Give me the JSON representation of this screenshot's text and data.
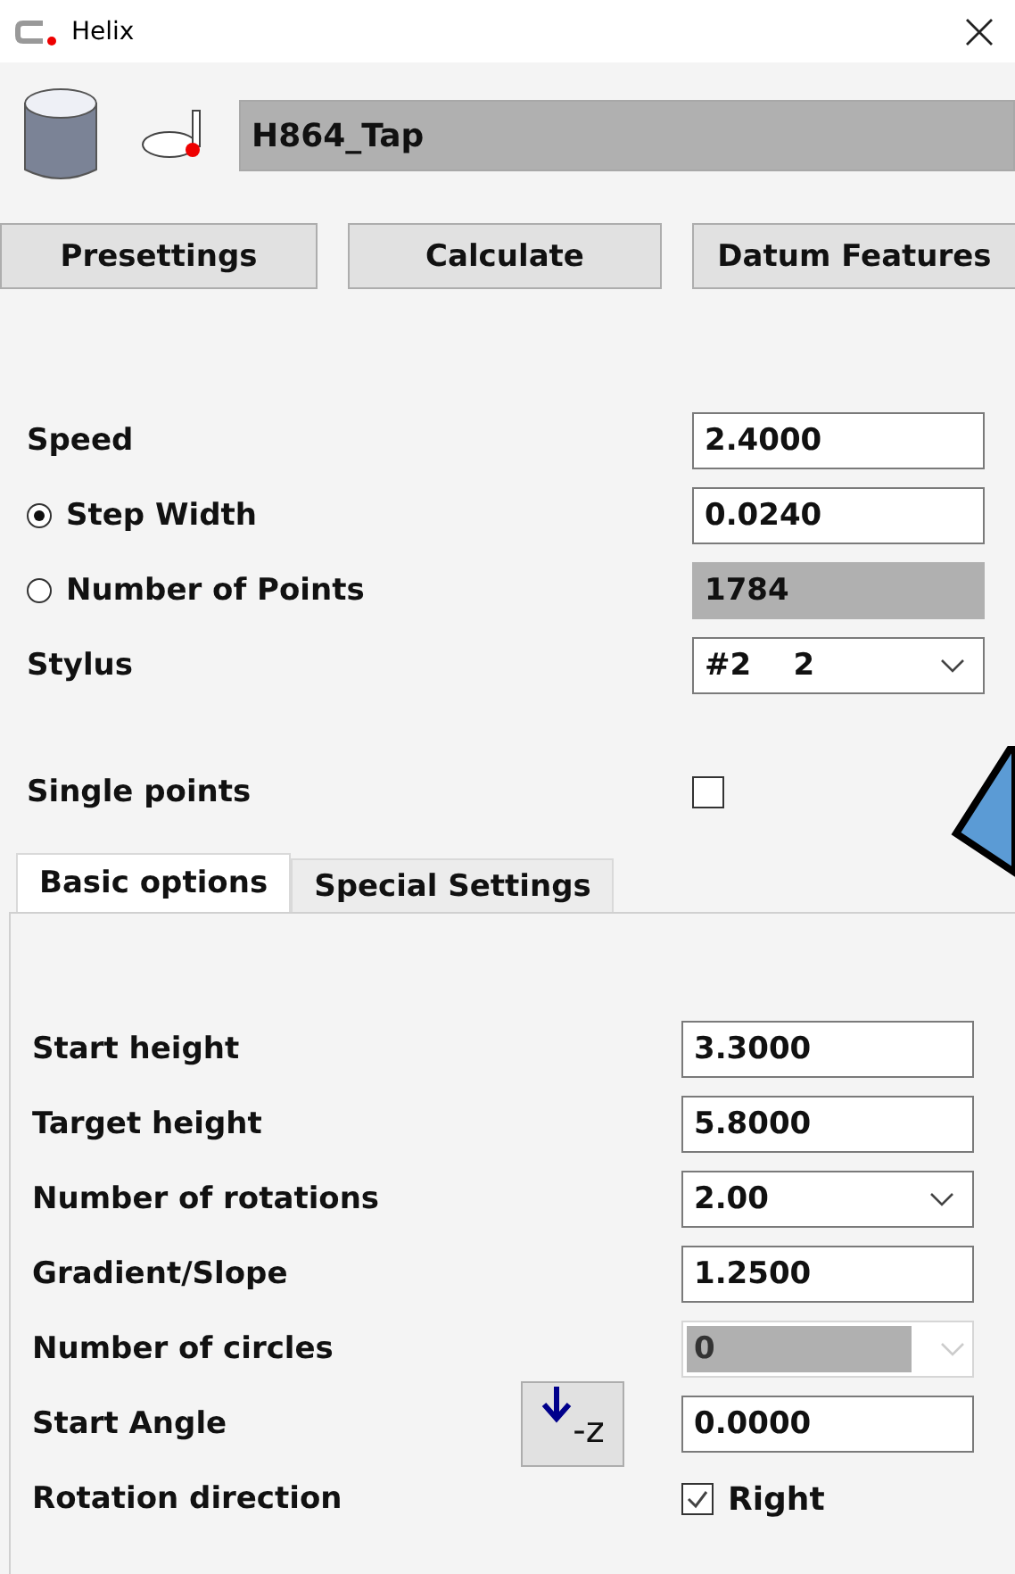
{
  "window": {
    "title": "Helix"
  },
  "header": {
    "name": "H864_Tap"
  },
  "buttons": [
    "Presettings",
    "Calculate",
    "Datum Features"
  ],
  "fields": [
    {
      "kind": "input",
      "label": "Speed",
      "value": "2.4000",
      "disabled": false
    },
    {
      "kind": "radio",
      "label": "Step Width",
      "selected": true,
      "value": "0.0240",
      "disabled": false
    },
    {
      "kind": "radio",
      "label": "Number of Points",
      "selected": false,
      "value": "1784",
      "disabled": true
    },
    {
      "kind": "select",
      "label": "Stylus",
      "value": "#2    2",
      "disabled": false
    }
  ],
  "single_points": {
    "label": "Single points",
    "checked": false
  },
  "tabs": [
    {
      "label": "Basic options",
      "selected": true
    },
    {
      "label": "Special Settings",
      "selected": false
    }
  ],
  "options": [
    {
      "kind": "input",
      "label": "Start height",
      "value": "3.3000",
      "disabled": false
    },
    {
      "kind": "input",
      "label": "Target height",
      "value": "5.8000",
      "disabled": false
    },
    {
      "kind": "select",
      "label": "Number of rotations",
      "value": "2.00",
      "disabled": false
    },
    {
      "kind": "input",
      "label": "Gradient/Slope",
      "value": "1.2500",
      "disabled": false
    },
    {
      "kind": "select",
      "label": "Number of circles",
      "value": "0",
      "disabled": true
    },
    {
      "kind": "input",
      "label": "Start Angle",
      "value": "0.0000",
      "disabled": false,
      "button": "-z"
    },
    {
      "kind": "checkbox",
      "label": "Rotation direction",
      "checked": true,
      "text": "Right"
    }
  ]
}
